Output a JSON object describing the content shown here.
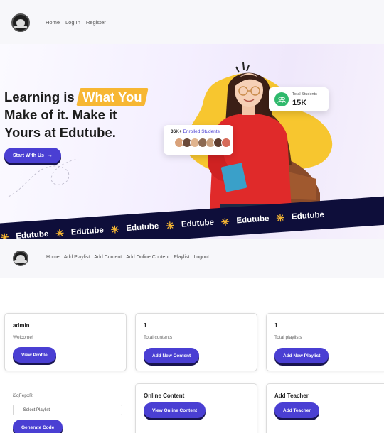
{
  "nav": {
    "links": [
      "Home",
      "Log In",
      "Register"
    ]
  },
  "hero": {
    "headline_pre": "Learning is",
    "headline_highlight": "What You",
    "headline_line2": "Make of it. Make it",
    "headline_line3": "Yours at Edutube.",
    "cta_label": "Start With Us",
    "cta_arrow": "→",
    "students_card": {
      "label": "Total Students",
      "value": "15K",
      "icon": "users-icon"
    },
    "enrolled_card": {
      "count": "36K+",
      "label": "Enrolled Students"
    },
    "ribbon": [
      "Edutube",
      "Edutube",
      "Edutube",
      "Edutube",
      "Edutube",
      "Edutube"
    ],
    "ribbon_star": "✳",
    "colors": {
      "accent": "#4a3fd3",
      "highlight": "#f7b733",
      "ribbon": "#0e0e3a",
      "success": "#2fb96c"
    }
  },
  "dashboard_nav": {
    "links": [
      "Home",
      "Add Playlist",
      "Add Content",
      "Add Online Content",
      "Playlist",
      "Logout"
    ]
  },
  "dashboard": {
    "profile": {
      "name": "admin",
      "welcome": "Welcome!",
      "button": "View Profile"
    },
    "contents": {
      "count": "1",
      "label": "Total contents",
      "button": "Add New Content"
    },
    "playlists": {
      "count": "1",
      "label": "Total playlists",
      "button": "Add New Playlist"
    },
    "code_gen": {
      "code": "i3qFepxR",
      "select_value": "-- Select Playlist --",
      "button": "Generate Code"
    },
    "online": {
      "title": "Online Content",
      "button": "View Online Content"
    },
    "teacher": {
      "title": "Add Teacher",
      "button": "Add Teacher"
    }
  }
}
